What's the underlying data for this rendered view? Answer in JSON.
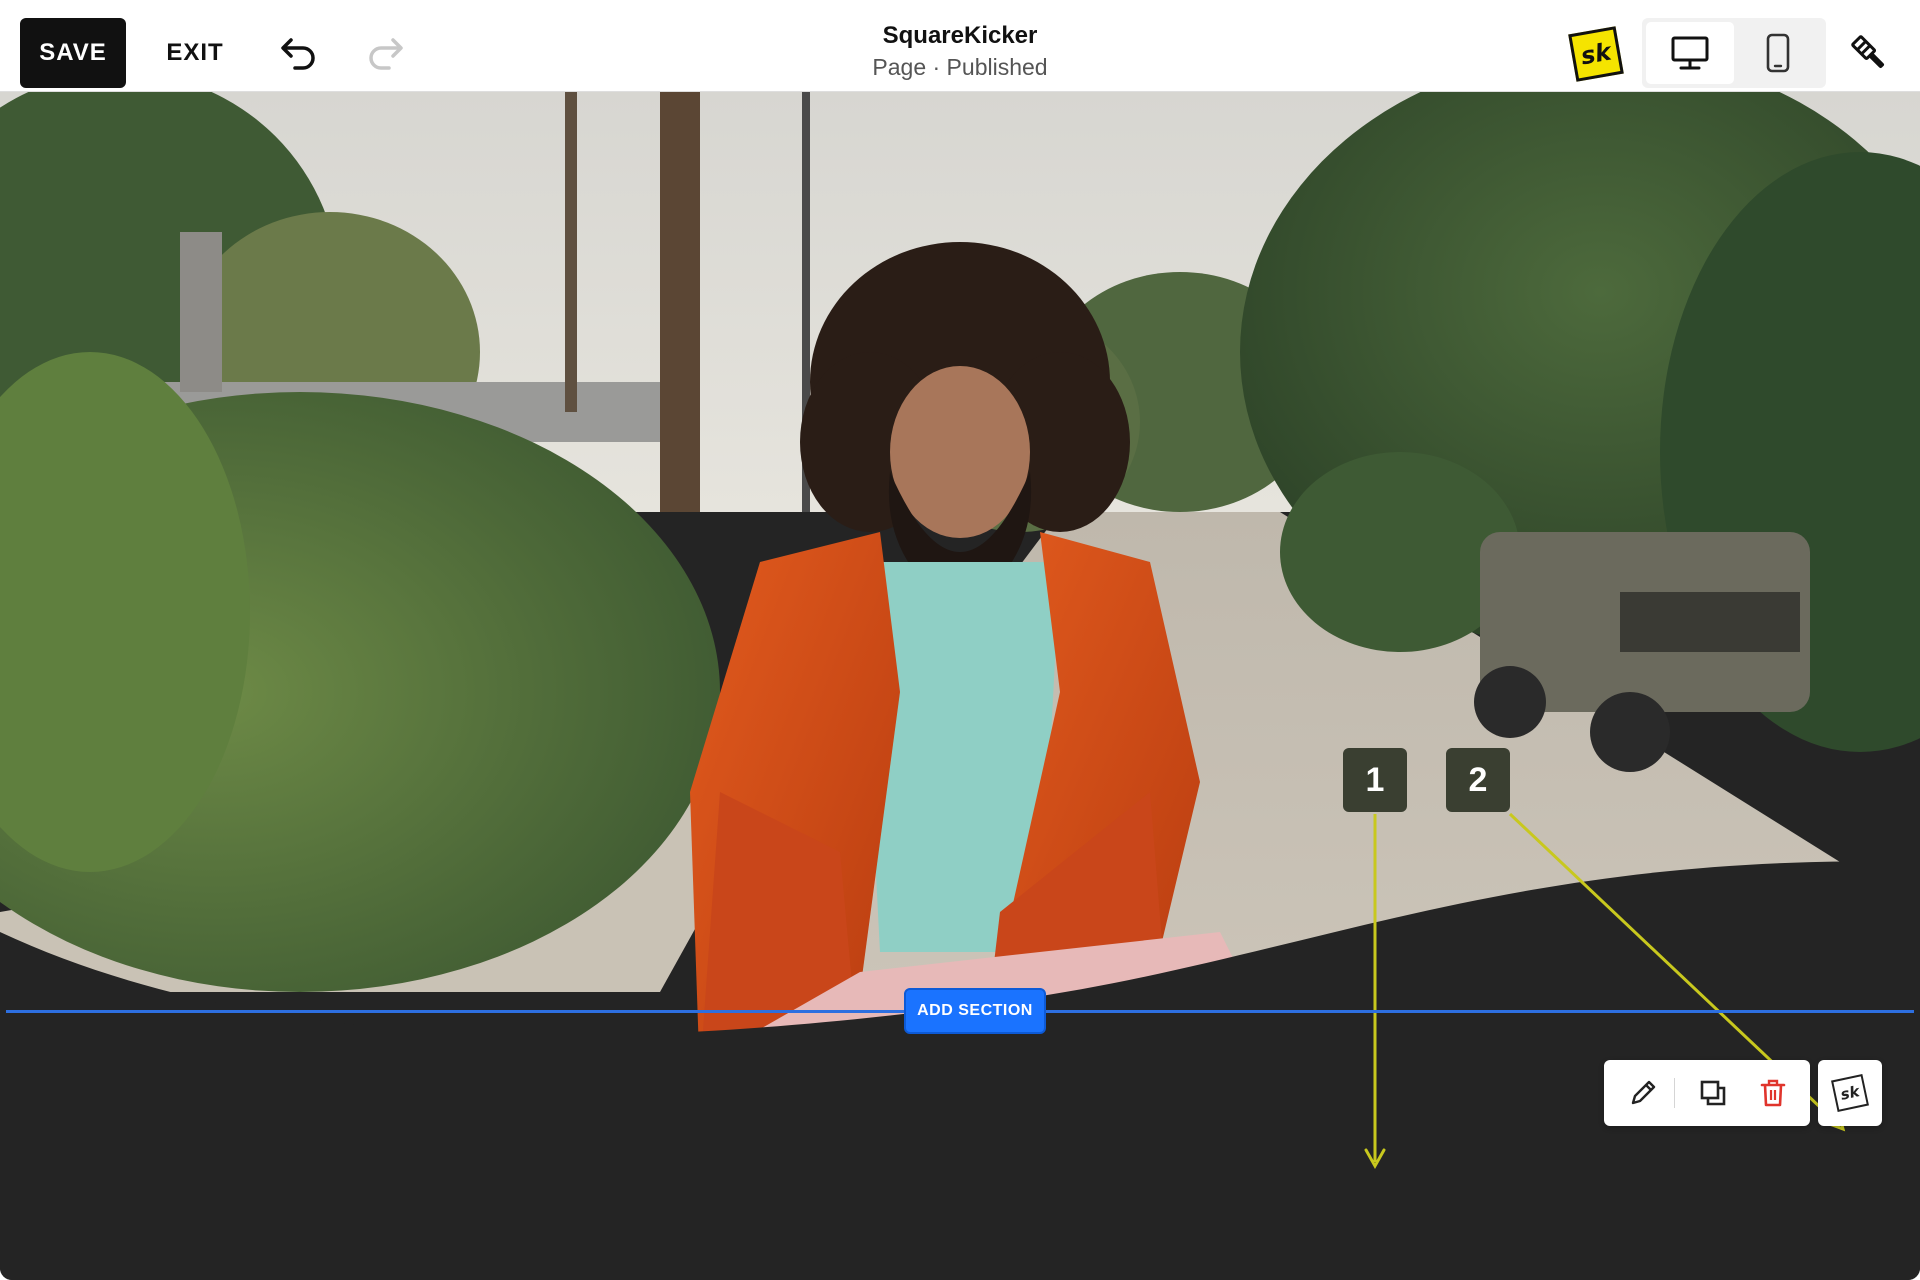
{
  "toolbar": {
    "save_label": "SAVE",
    "exit_label": "EXIT",
    "undo_icon": "undo-icon",
    "redo_icon": "redo-icon"
  },
  "header": {
    "title": "SquareKicker",
    "subtitle": "Page · Published"
  },
  "right_tools": {
    "logo_text": "sk",
    "desktop_icon": "desktop-icon",
    "mobile_icon": "mobile-icon",
    "design_icon": "paint-brush-icon",
    "active_device": "desktop"
  },
  "callouts": [
    "1",
    "2"
  ],
  "section": {
    "add_label": "ADD SECTION"
  },
  "block_toolbar": {
    "edit_icon": "pencil-icon",
    "duplicate_icon": "duplicate-icon",
    "delete_icon": "trash-icon",
    "sk_label": "sk"
  },
  "colors": {
    "accent_blue": "#1a73ff",
    "callout_bg": "#3a3f31",
    "arrow": "#c8c81e",
    "delete_red": "#e0342c",
    "dark_section": "#242424"
  }
}
